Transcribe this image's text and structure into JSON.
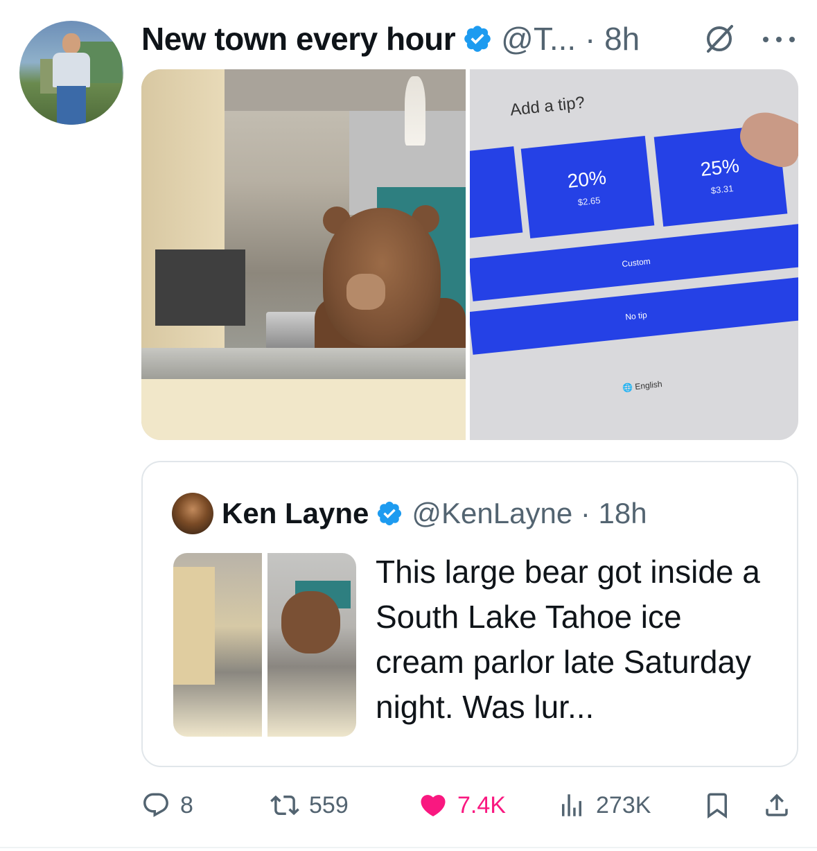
{
  "tweet": {
    "author_name": "New town every hour",
    "handle_time": "@T... · 8h",
    "icons": {
      "verified": "verified-badge-icon",
      "mute": "mute-icon",
      "more": "more-icon"
    },
    "media": {
      "left_image": "bear-in-ice-cream-parlor-photo",
      "right_image": {
        "title": "Add a tip?",
        "options": [
          {
            "label": "20%",
            "amount": "$2.65"
          },
          {
            "label": "25%",
            "amount": "$3.31"
          }
        ],
        "custom_label": "Custom",
        "no_tip_label": "No tip",
        "language_label": "English"
      }
    }
  },
  "quoted": {
    "author_name": "Ken Layne",
    "handle_time": "@KenLayne · 18h",
    "text": "This large bear got inside a South Lake Tahoe ice cream parlor late Saturday night. Was lur..."
  },
  "actions": {
    "replies": "8",
    "reposts": "559",
    "likes": "7.4K",
    "views": "273K"
  },
  "colors": {
    "verified": "#1d9bf0",
    "like": "#f91880",
    "secondary_text": "#536471",
    "tip_blue": "#2541e6"
  }
}
